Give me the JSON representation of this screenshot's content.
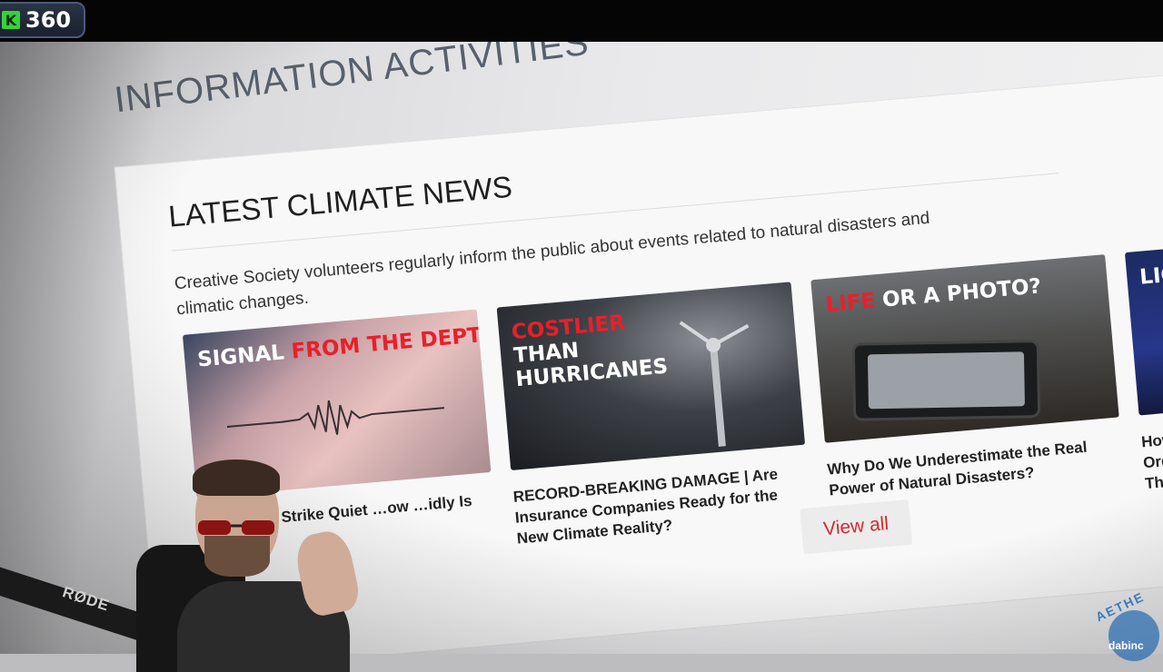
{
  "overlay": {
    "badge_letter": "K",
    "badge_value": "360",
    "mic_brand": "RØDE",
    "watermark_top": "AETHE",
    "watermark_sub": "dabinc"
  },
  "page": {
    "section_title": "INFORMATION ACTIVITIES",
    "card": {
      "title": "LATEST CLIMATE NEWS",
      "description": "Creative Society volunteers regularly inform the public about events related to natural disasters and climatic changes.",
      "view_all": "View all"
    },
    "news": [
      {
        "tag_white": "SIGNAL ",
        "tag_red": "FROM THE DEPTHS",
        "title": "…nquakes Strike Quiet …ow …idly Is Our …nge"
      },
      {
        "tag_red": "COSTLIER",
        "tag_white": "THAN HURRICANES",
        "title": "RECORD-BREAKING DAMAGE | Are Insurance Companies Ready for the New Climate Reality?"
      },
      {
        "tag_red": "LIFE",
        "tag_white": " OR A PHOTO?",
        "title": "Why Do We Underestimate the Real Power of Natural Disasters?"
      },
      {
        "tag_white": "LIGHT",
        "title": "How I Ordin Thre"
      }
    ]
  },
  "colors": {
    "accent_red": "#d22b2b",
    "badge_green": "#35d33a"
  }
}
